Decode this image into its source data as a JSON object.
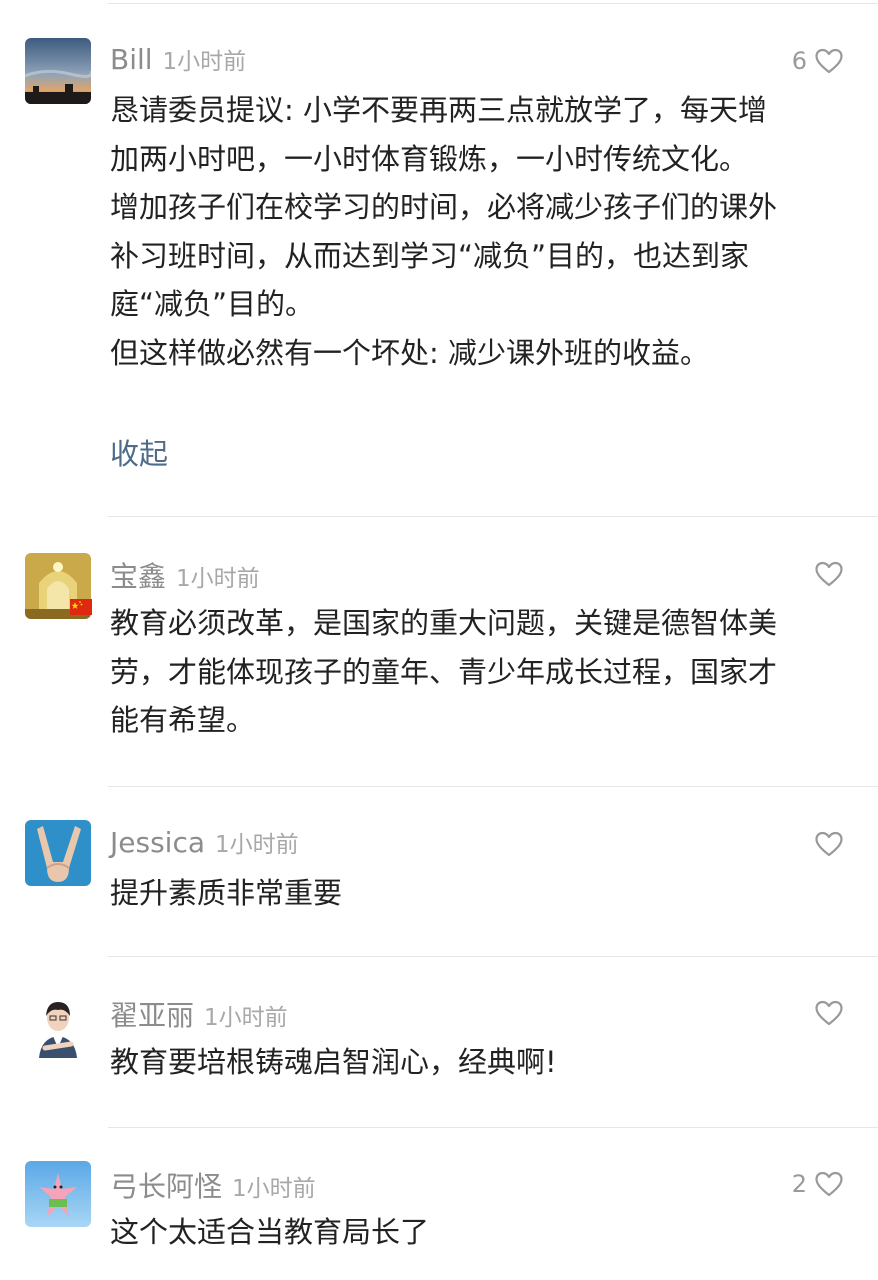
{
  "comments": [
    {
      "username": "Bill",
      "time": "1小时前",
      "likes": "6",
      "paragraphs": [
        "恳请委员提议: 小学不要再两三点就放学了，每天增加两小时吧，一小时体育锻炼，一小时传统文化。",
        "增加孩子们在校学习的时间，必将减少孩子们的课外补习班时间，从而达到学习“减负”目的，也达到家庭“减负”目的。",
        "但这样做必然有一个坏处: 减少课外班的收益。"
      ],
      "collapse_label": "收起",
      "avatar_icon": "sunset-sky-avatar"
    },
    {
      "username": "宝鑫",
      "time": "1小时前",
      "likes": "",
      "paragraphs": [
        "教育必须改革，是国家的重大问题，关键是德智体美劳，才能体现孩子的童年、青少年成长过程，国家才能有希望。"
      ],
      "avatar_icon": "arched-hall-avatar",
      "badge_icon": "china-flag-icon"
    },
    {
      "username": "Jessica",
      "time": "1小时前",
      "likes": "",
      "paragraphs": [
        "提升素质非常重要"
      ],
      "avatar_icon": "victory-hand-avatar"
    },
    {
      "username": "翟亚丽",
      "time": "1小时前",
      "likes": "",
      "paragraphs": [
        "教育要培根铸魂启智润心，经典啊!"
      ],
      "avatar_icon": "person-portrait-avatar"
    },
    {
      "username": "弓长阿怪",
      "time": "1小时前",
      "likes": "2",
      "paragraphs": [
        "这个太适合当教育局长了"
      ],
      "avatar_icon": "cartoon-starfish-avatar"
    }
  ],
  "colors": {
    "username": "#8c8c8c",
    "time": "#a8a8a8",
    "body": "#222222",
    "link": "#4e6b8a",
    "divider": "#e6e6e6",
    "heart": "#9a9a9a"
  }
}
